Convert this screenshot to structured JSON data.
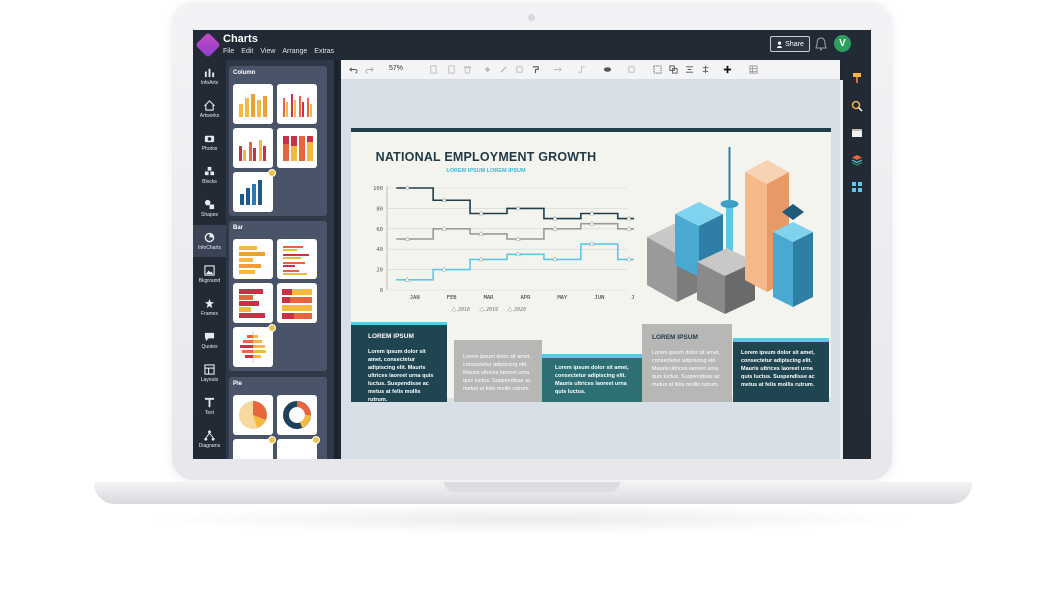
{
  "app": {
    "title": "Charts",
    "menu": [
      "File",
      "Edit",
      "View",
      "Arrange",
      "Extras"
    ],
    "share_label": "Share",
    "avatar_initial": "V"
  },
  "rail": {
    "items": [
      {
        "label": "InfoArts",
        "icon": "chart-icon"
      },
      {
        "label": "Artworks",
        "icon": "home-icon"
      },
      {
        "label": "Photos",
        "icon": "camera-icon"
      },
      {
        "label": "Blocks",
        "icon": "blocks-icon"
      },
      {
        "label": "Shapes",
        "icon": "shapes-icon"
      },
      {
        "label": "InfoCharts",
        "icon": "infocharts-icon",
        "active": true
      },
      {
        "label": "Bkground",
        "icon": "image-icon"
      },
      {
        "label": "Frames",
        "icon": "frames-icon"
      },
      {
        "label": "Quotes",
        "icon": "quote-icon"
      },
      {
        "label": "Layouts",
        "icon": "layout-icon"
      },
      {
        "label": "Text",
        "icon": "text-icon"
      },
      {
        "label": "Diagrams",
        "icon": "diagram-icon"
      }
    ]
  },
  "panel": {
    "groups": [
      {
        "title": "Column"
      },
      {
        "title": "Bar"
      },
      {
        "title": "Pie"
      }
    ]
  },
  "toolbar": {
    "zoom": "57%"
  },
  "infographic": {
    "title": "NATIONAL EMPLOYMENT GROWTH",
    "subtitle": "LOREM IPSUM LOREM IPSUM",
    "blocks": [
      {
        "head": "LOREM IPSUM",
        "text": "Lorem ipsum dolor sit amet, consectetur adipiscing elit. Mauris ultrices laoreet urna quis luctus. Suspendisse ac metus at felis mollis rutrum."
      },
      {
        "text": "Lorem ipsum dolor sit amet, consectetur adipiscing elit. Mauris ultrices laoreet urna quis luctus. Suspendisse ac metus at felis mollis rutrum."
      },
      {
        "text": "Lorem ipsum dolor sit amet, consectetur adipiscing elit. Mauris ultrices laoreet urna quis luctus."
      },
      {
        "head": "LOREM IPSUM",
        "text": "Lorem ipsum dolor sit amet, consectetur adipiscing elit. Mauris ultrices laoreet urna quis luctus. Suspendisse ac metus at felis mollis rutrum."
      },
      {
        "text": "Lorem ipsum dolor sit amet, consectetur adipiscing elit. Mauris ultrices laoreet urna quis luctus. Suspendisse ac metus at felis mollis rutrum."
      }
    ],
    "colors": {
      "dark_teal": "#1f4650",
      "grey": "#b7b7b5",
      "teal": "#2e6f73",
      "accent": "#5fc7e6"
    }
  },
  "chart_data": {
    "type": "line",
    "categories": [
      "JAN",
      "FEB",
      "MAR",
      "APR",
      "MAY",
      "JUN",
      "JUL"
    ],
    "ylim": [
      0,
      100
    ],
    "yticks": [
      0,
      20,
      40,
      60,
      80,
      100
    ],
    "series": [
      {
        "name": "2018",
        "color": "#1f3f4a",
        "values": [
          100,
          88,
          75,
          80,
          70,
          75,
          70
        ]
      },
      {
        "name": "2019",
        "color": "#9a9a9a",
        "values": [
          50,
          60,
          55,
          50,
          60,
          65,
          60
        ]
      },
      {
        "name": "2020",
        "color": "#5fc7e6",
        "values": [
          10,
          20,
          30,
          35,
          30,
          45,
          30
        ]
      }
    ],
    "legend": "bottom"
  }
}
